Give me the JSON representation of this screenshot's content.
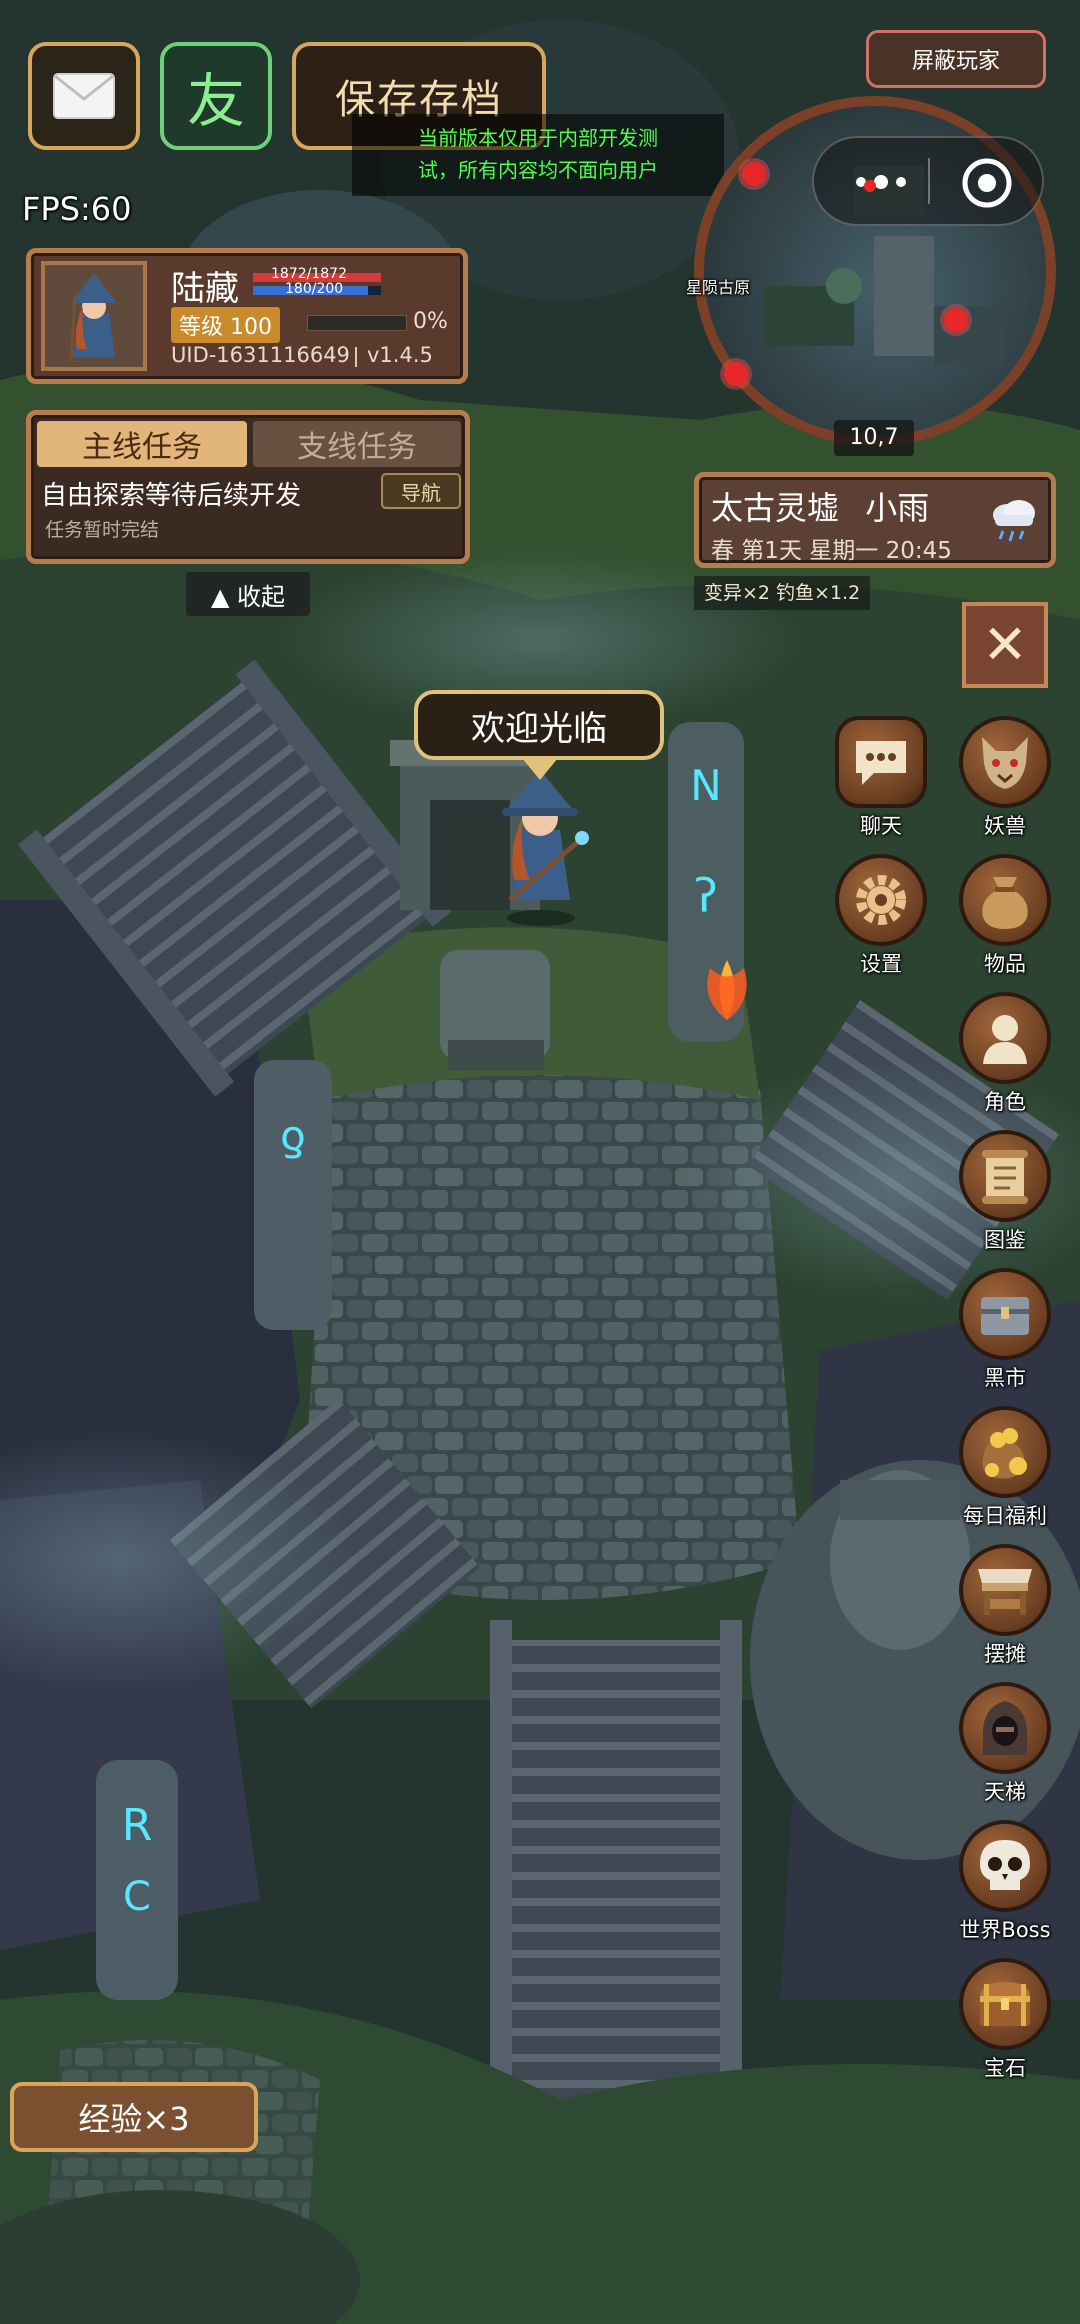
{
  "top_buttons": {
    "mail_icon": "envelope-icon",
    "friend_label": "友",
    "save_label": "保存存档",
    "hide_players_label": "屏蔽玩家"
  },
  "notice": {
    "line1": "当前版本仅用于内部开发测",
    "line2": "试，所有内容均不面向用户"
  },
  "fps": "FPS:60",
  "player": {
    "name": "陆藏",
    "hp": "1872/1872",
    "mp": "180/200",
    "hp_fraction": 1.0,
    "mp_fraction": 0.9,
    "level_label": "等级 100",
    "exp_percent": "0%",
    "exp_fraction": 0.0,
    "uid": "UID-1631116649",
    "version": "v1.4.5"
  },
  "quest": {
    "tab_main": "主线任务",
    "tab_side": "支线任务",
    "title": "自由探索等待后续开发",
    "nav_label": "导航",
    "status": "任务暂时完结",
    "collapse_label": "▲ 收起"
  },
  "minimap": {
    "area_label": "星陨古原",
    "coords": "10,7",
    "more_icon": "more-dots-icon",
    "target_icon": "target-icon"
  },
  "location": {
    "name": "太古灵墟",
    "weather": "小雨",
    "date": "春 第1天 星期一 20:45",
    "weather_icon": "rain-cloud-icon",
    "buffs": "变异×2 钓鱼×1.2"
  },
  "npc_greeting": "欢迎光临",
  "close_label": "✕",
  "side_menu": [
    {
      "label": "聊天",
      "icon": "chat-bubble-icon"
    },
    {
      "label": "妖兽",
      "icon": "wolf-head-icon"
    },
    {
      "label": "设置",
      "icon": "gear-icon"
    },
    {
      "label": "物品",
      "icon": "bag-icon"
    },
    {
      "label": "角色",
      "icon": "person-icon"
    },
    {
      "label": "图鉴",
      "icon": "scroll-icon"
    },
    {
      "label": "黑市",
      "icon": "chest-icon"
    },
    {
      "label": "每日福利",
      "icon": "gold-bag-icon"
    },
    {
      "label": "摆摊",
      "icon": "stall-icon"
    },
    {
      "label": "天梯",
      "icon": "hooded-figure-icon"
    },
    {
      "label": "世界Boss",
      "icon": "skull-icon"
    },
    {
      "label": "宝石",
      "icon": "treasure-chest-icon"
    }
  ],
  "exp_bonus": "经验×3",
  "colors": {
    "panel_bg": "#5a3a2c",
    "panel_border": "#b57d4d",
    "button_border": "#d8a65c",
    "friend_border": "#6fd07a",
    "notice_text": "#4cff4c",
    "level_badge": "#c98a2c"
  }
}
